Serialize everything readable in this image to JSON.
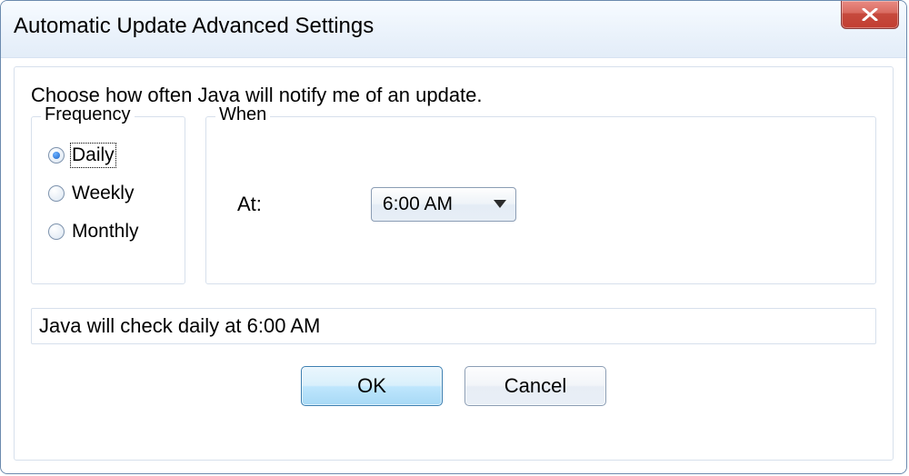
{
  "window": {
    "title": "Automatic Update Advanced Settings",
    "close_icon_name": "close-icon"
  },
  "instruction": "Choose how often Java will notify me of an update.",
  "frequency": {
    "legend": "Frequency",
    "options": {
      "daily": {
        "label": "Daily",
        "selected": true,
        "focused": true
      },
      "weekly": {
        "label": "Weekly",
        "selected": false,
        "focused": false
      },
      "monthly": {
        "label": "Monthly",
        "selected": false,
        "focused": false
      }
    }
  },
  "when": {
    "legend": "When",
    "at_label": "At:",
    "time_value": "6:00 AM"
  },
  "status_text": "Java will check daily at 6:00 AM",
  "buttons": {
    "ok": "OK",
    "cancel": "Cancel"
  }
}
